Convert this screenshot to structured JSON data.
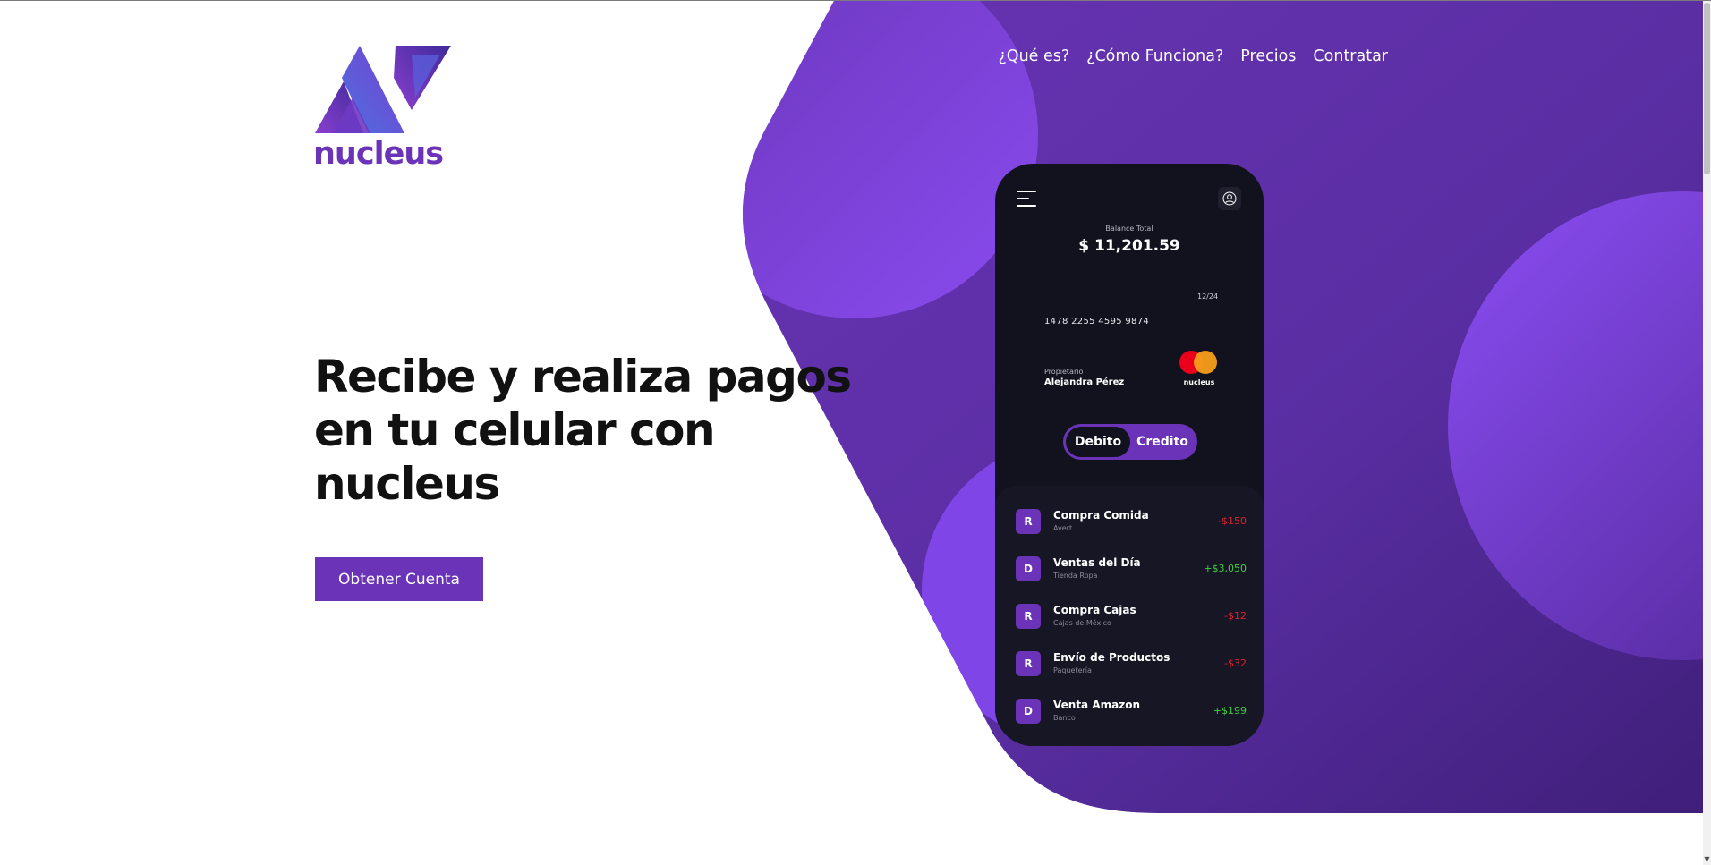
{
  "brand": {
    "name": "nucleus",
    "color": "#6a33b8"
  },
  "nav": {
    "items": [
      "¿Qué es?",
      "¿Cómo Funciona?",
      "Precios",
      "Contratar"
    ]
  },
  "hero": {
    "title": "Recibe y realiza pagos en tu celular con nucleus",
    "cta_label": "Obtener Cuenta"
  },
  "phone": {
    "menu_icon": "hamburger-menu-icon",
    "profile_icon": "user-profile-icon",
    "balance_label": "Balance Total",
    "balance_value": "$ 11,201.59",
    "card": {
      "expiry": "12/24",
      "number": "1478 2255 4595 9874",
      "owner_label": "Propietario",
      "owner_name": "Alejandra Pérez",
      "network_icon": "mastercard-logo",
      "brand_label": "nucleus"
    },
    "toggle": {
      "debit_label": "Debito",
      "credit_label": "Credito",
      "selected": "Debito"
    },
    "transactions": [
      {
        "badge": "R",
        "name": "Compra Comida",
        "subtitle": "Avert",
        "amount": "-$150",
        "type": "negative"
      },
      {
        "badge": "D",
        "name": "Ventas del Día",
        "subtitle": "Tienda Ropa",
        "amount": "+$3,050",
        "type": "positive"
      },
      {
        "badge": "R",
        "name": "Compra Cajas",
        "subtitle": "Cajas de México",
        "amount": "-$12",
        "type": "negative"
      },
      {
        "badge": "R",
        "name": "Envío de Productos",
        "subtitle": "Paquetería",
        "amount": "-$32",
        "type": "negative"
      },
      {
        "badge": "D",
        "name": "Venta Amazon",
        "subtitle": "Banco",
        "amount": "+$199",
        "type": "positive"
      }
    ]
  },
  "colors": {
    "accent": "#6a33b8",
    "background_purple": "#5b2ea6",
    "phone_bg": "#12121f",
    "negative": "#e0202e",
    "positive": "#3fd23f"
  }
}
